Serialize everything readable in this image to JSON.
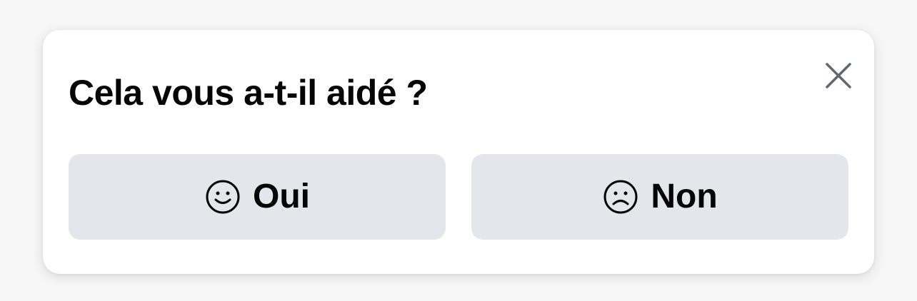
{
  "feedback": {
    "question": "Cela vous a-t-il aidé ?",
    "close_icon": "close-icon",
    "yes": {
      "label": "Oui",
      "icon": "smile-icon"
    },
    "no": {
      "label": "Non",
      "icon": "frown-icon"
    }
  },
  "colors": {
    "card_background": "#ffffff",
    "button_background": "#e4e6eb",
    "text": "#050505",
    "icon": "#606770"
  }
}
